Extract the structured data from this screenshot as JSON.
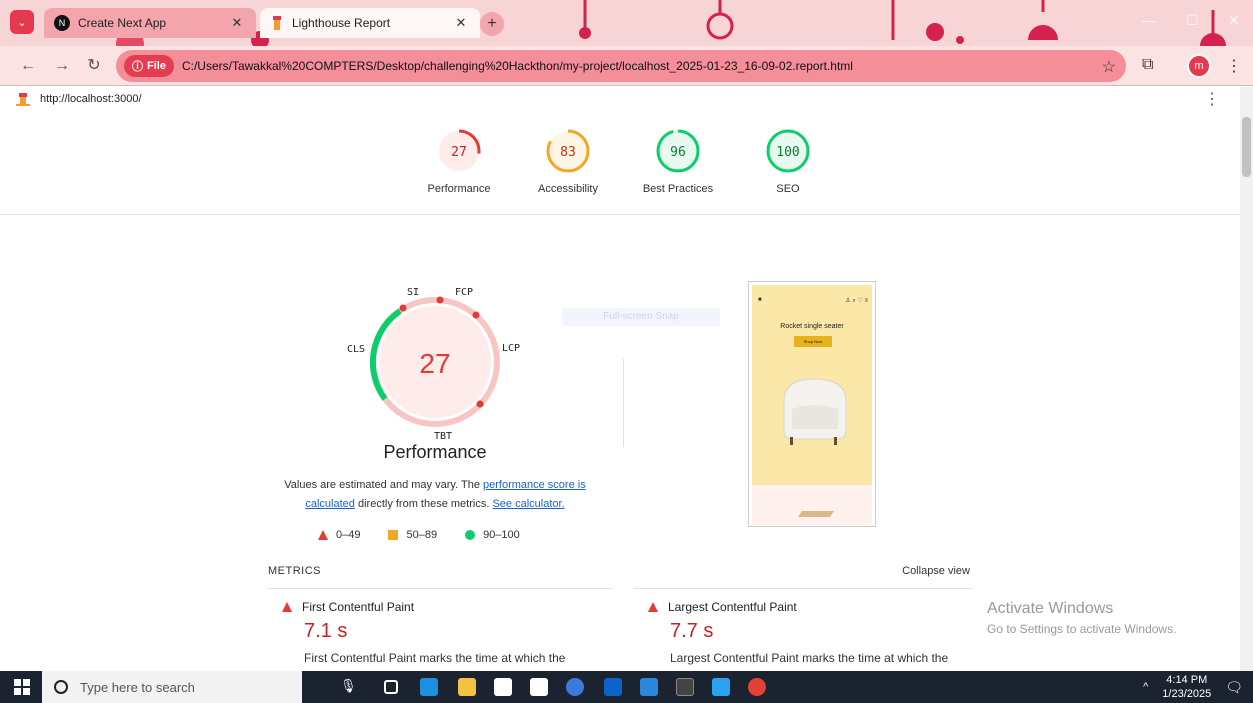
{
  "browser": {
    "tabs": [
      {
        "title": "Create Next App",
        "active": false
      },
      {
        "title": "Lighthouse Report",
        "active": true
      }
    ],
    "file_chip": "File",
    "url": "C:/Users/Tawakkal%20COMPTERS/Desktop/challenging%20Hackthon/my-project/localhost_2025-01-23_16-09-02.report.html",
    "profile_initial": "m"
  },
  "report": {
    "site_url": "http://localhost:3000/",
    "categories": [
      {
        "label": "Performance",
        "score": 27,
        "color": "#e53935",
        "fill": "#fdecea"
      },
      {
        "label": "Accessibility",
        "score": 83,
        "color": "#f5a623",
        "fill": "#fff6e8"
      },
      {
        "label": "Best Practices",
        "score": 96,
        "color": "#0cce6b",
        "fill": "#e8f9ef"
      },
      {
        "label": "SEO",
        "score": 100,
        "color": "#0cce6b",
        "fill": "#e8f9ef"
      }
    ],
    "performance": {
      "score": "27",
      "title": "Performance",
      "metric_labels": {
        "si": "SI",
        "fcp": "FCP",
        "lcp": "LCP",
        "tbt": "TBT",
        "cls": "CLS"
      },
      "note_prefix": "Values are estimated and may vary. The ",
      "note_link1": "performance score is calculated",
      "note_mid": " directly from these metrics. ",
      "note_link2": "See calculator.",
      "legend": [
        "0–49",
        "50–89",
        "90–100"
      ]
    },
    "fullscreen_hint": "Full-screen Snap",
    "screenshot": {
      "title": "Rocket single seater",
      "button": "Shop Now"
    },
    "metrics_heading": "METRICS",
    "collapse_label": "Collapse view",
    "metrics": [
      {
        "name": "First Contentful Paint",
        "value": "7.1 s",
        "desc": "First Contentful Paint marks the time at which the"
      },
      {
        "name": "Largest Contentful Paint",
        "value": "7.7 s",
        "desc": "Largest Contentful Paint marks the time at which the"
      }
    ]
  },
  "watermark": {
    "line1": "Activate Windows",
    "line2": "Go to Settings to activate Windows."
  },
  "taskbar": {
    "search_placeholder": "Type here to search",
    "time": "4:14 PM",
    "date": "1/23/2025"
  }
}
